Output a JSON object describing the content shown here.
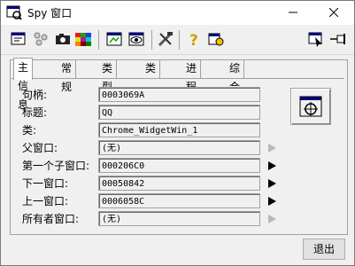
{
  "window": {
    "title": "Spy 窗口",
    "min_icon": "minimize-icon",
    "close_icon": "close-icon"
  },
  "toolbar": {
    "icons": [
      "window-tree-icon",
      "processes-icon",
      "camera-icon",
      "color-grid-icon",
      "window-view-icon",
      "eye-icon",
      "tools-icon",
      "help-icon",
      "info-icon",
      "finder-cursor-icon",
      "pin-icon"
    ]
  },
  "tabs": [
    "主信息",
    "常规",
    "类型",
    "类",
    "进程",
    "综合"
  ],
  "rows": [
    {
      "label": "句柄:",
      "value": "0003069A",
      "arrow": null
    },
    {
      "label": "标题:",
      "value": "QQ",
      "arrow": null
    },
    {
      "label": "类:",
      "value": "Chrome_WidgetWin_1",
      "arrow": null
    },
    {
      "label": "父窗口:",
      "value": "(无)",
      "arrow": "disabled"
    },
    {
      "label": "第一个子窗口:",
      "value": "000206C0",
      "arrow": "enabled"
    },
    {
      "label": "下一窗口:",
      "value": "00050842",
      "arrow": "enabled"
    },
    {
      "label": "上一窗口:",
      "value": "0006058C",
      "arrow": "enabled"
    },
    {
      "label": "所有者窗口:",
      "value": "(无)",
      "arrow": "disabled"
    }
  ],
  "exit_label": "退出",
  "colors": {
    "background": "#f0f0f0",
    "border": "#a0a0a0"
  }
}
